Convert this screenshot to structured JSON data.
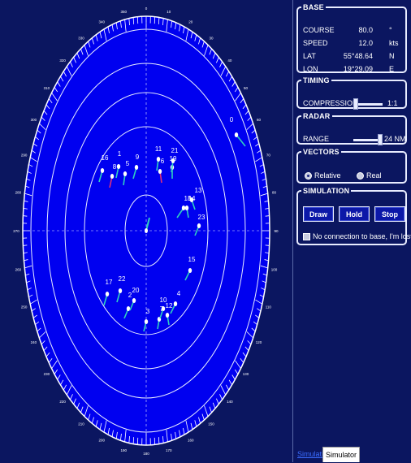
{
  "radar": {
    "compass_labels": [
      "0",
      "10",
      "20",
      "30",
      "40",
      "50",
      "60",
      "70",
      "80",
      "90",
      "100",
      "110",
      "120",
      "130",
      "140",
      "150",
      "160",
      "170",
      "180",
      "190",
      "200",
      "210",
      "220",
      "230",
      "240",
      "250",
      "260",
      "270",
      "280",
      "290",
      "300",
      "310",
      "320",
      "330",
      "340",
      "350"
    ],
    "targets": [
      {
        "id": "0"
      },
      {
        "id": "1"
      },
      {
        "id": "2"
      },
      {
        "id": "3"
      },
      {
        "id": "4"
      },
      {
        "id": "5"
      },
      {
        "id": "6"
      },
      {
        "id": "7"
      },
      {
        "id": "8"
      },
      {
        "id": "9"
      },
      {
        "id": "10"
      },
      {
        "id": "11"
      },
      {
        "id": "12"
      },
      {
        "id": "13"
      },
      {
        "id": "14"
      },
      {
        "id": "15"
      },
      {
        "id": "16"
      },
      {
        "id": "17"
      },
      {
        "id": "18"
      },
      {
        "id": "19"
      },
      {
        "id": "20"
      },
      {
        "id": "21"
      },
      {
        "id": "22"
      },
      {
        "id": "23"
      }
    ],
    "colors": {
      "scope": "#0000f0",
      "ring": "#e8ecff",
      "vector": "#2fd0c0",
      "vector_alt": "#e0307a"
    }
  },
  "base": {
    "legend": "BASE",
    "course_label": "COURSE",
    "course_value": "80.0",
    "course_unit": "°",
    "speed_label": "SPEED",
    "speed_value": "12.0",
    "speed_unit": "kts",
    "lat_label": "LAT",
    "lat_value": "55°48.64",
    "lat_unit": "N",
    "lon_label": "LON",
    "lon_value": "19°29.09",
    "lon_unit": "E"
  },
  "timing": {
    "legend": "TIMING",
    "compression_label": "COMPRESSION",
    "compression_value": "1:1"
  },
  "radar_panel": {
    "legend": "RADAR",
    "range_label": "RANGE",
    "range_value": "24 NM"
  },
  "vectors": {
    "legend": "VECTORS",
    "relative_label": "Relative",
    "real_label": "Real",
    "selected": "Relative"
  },
  "simulation": {
    "legend": "SIMULATION",
    "draw_label": "Draw",
    "hold_label": "Hold",
    "stop_label": "Stop",
    "no_connection_label": "No connection to base, I'm lost"
  },
  "tabs": {
    "inactive_label": "Simulation",
    "active_label": "Simulator"
  }
}
